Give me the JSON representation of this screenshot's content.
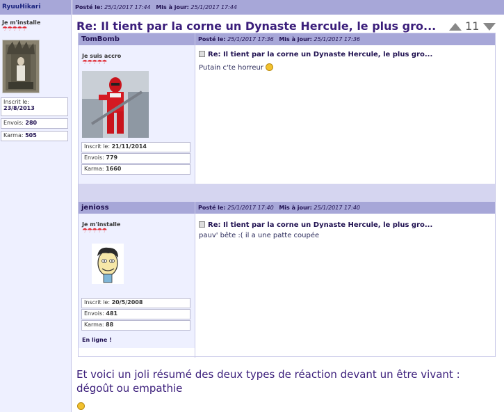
{
  "outer_author": {
    "name": "RyuuHikari",
    "status": "Je m'installe",
    "umbrellas": "☂☂☂☂☂",
    "registered_label": "Inscrit le:",
    "registered_value": "23/8/2013",
    "posts_label": "Envois:",
    "posts_value": "280",
    "karma_label": "Karma:",
    "karma_value": "505"
  },
  "outer_header": {
    "posted_label": "Posté le:",
    "posted_value": "25/1/2017 17:44",
    "updated_label": "Mis à jour:",
    "updated_value": "25/1/2017 17:44"
  },
  "post_title": "Re: Il tient par la corne un Dynaste Hercule, le plus gro...",
  "pager_number": "11",
  "quoted_posts": [
    {
      "author": "TomBomb",
      "status": "Je suis accro",
      "umbrellas": "☂☂☂☂☂",
      "registered_label": "Inscrit le:",
      "registered_value": "21/11/2014",
      "posts_label": "Envois:",
      "posts_value": "779",
      "karma_label": "Karma:",
      "karma_value": "1660",
      "posted_label": "Posté le:",
      "posted_value": "25/1/2017 17:36",
      "updated_label": "Mis à jour:",
      "updated_value": "25/1/2017 17:36",
      "title": "Re: Il tient par la corne un Dynaste Hercule, le plus gro...",
      "body": "Putain c'te horreur"
    },
    {
      "author": "jenioss",
      "status": "Je m'installe",
      "umbrellas": "☂☂☂☂☂",
      "registered_label": "Inscrit le:",
      "registered_value": "20/5/2008",
      "posts_label": "Envois:",
      "posts_value": "481",
      "karma_label": "Karma:",
      "karma_value": "88",
      "online": "En ligne !",
      "posted_label": "Posté le:",
      "posted_value": "25/1/2017 17:40",
      "updated_label": "Mis à jour:",
      "updated_value": "25/1/2017 17:40",
      "title": "Re: Il tient par la corne un Dynaste Hercule, le plus gro...",
      "body": "pauv' bête :( il a une patte coupée"
    }
  ],
  "message_body": "Et voici un joli résumé des deux types de réaction devant un être vivant : dégoût ou empathie",
  "colors": {
    "header_bar": "#a7a7d8",
    "sidebar_bg": "#eef0ff",
    "title_color": "#3a1d7a"
  }
}
